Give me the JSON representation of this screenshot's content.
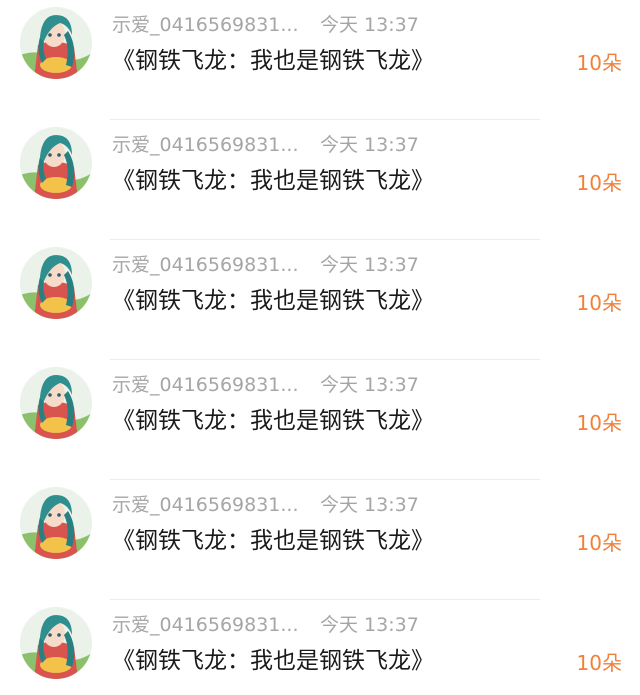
{
  "feed": {
    "items": [
      {
        "user": "示爱_0416569831...",
        "time": "今天 13:37",
        "title": "《钢铁飞龙：我也是钢铁飞龙》",
        "count": "10朵"
      },
      {
        "user": "示爱_0416569831...",
        "time": "今天 13:37",
        "title": "《钢铁飞龙：我也是钢铁飞龙》",
        "count": "10朵"
      },
      {
        "user": "示爱_0416569831...",
        "time": "今天 13:37",
        "title": "《钢铁飞龙：我也是钢铁飞龙》",
        "count": "10朵"
      },
      {
        "user": "示爱_0416569831...",
        "time": "今天 13:37",
        "title": "《钢铁飞龙：我也是钢铁飞龙》",
        "count": "10朵"
      },
      {
        "user": "示爱_0416569831...",
        "time": "今天 13:37",
        "title": "《钢铁飞龙：我也是钢铁飞龙》",
        "count": "10朵"
      },
      {
        "user": "示爱_0416569831...",
        "time": "今天 13:37",
        "title": "《钢铁飞龙：我也是钢铁飞龙》",
        "count": "10朵"
      }
    ],
    "avatar_icon": "anime-character-avatar",
    "colors": {
      "count": "#f0813a",
      "meta": "#a6a6a6",
      "title": "#1a1a1a"
    }
  }
}
